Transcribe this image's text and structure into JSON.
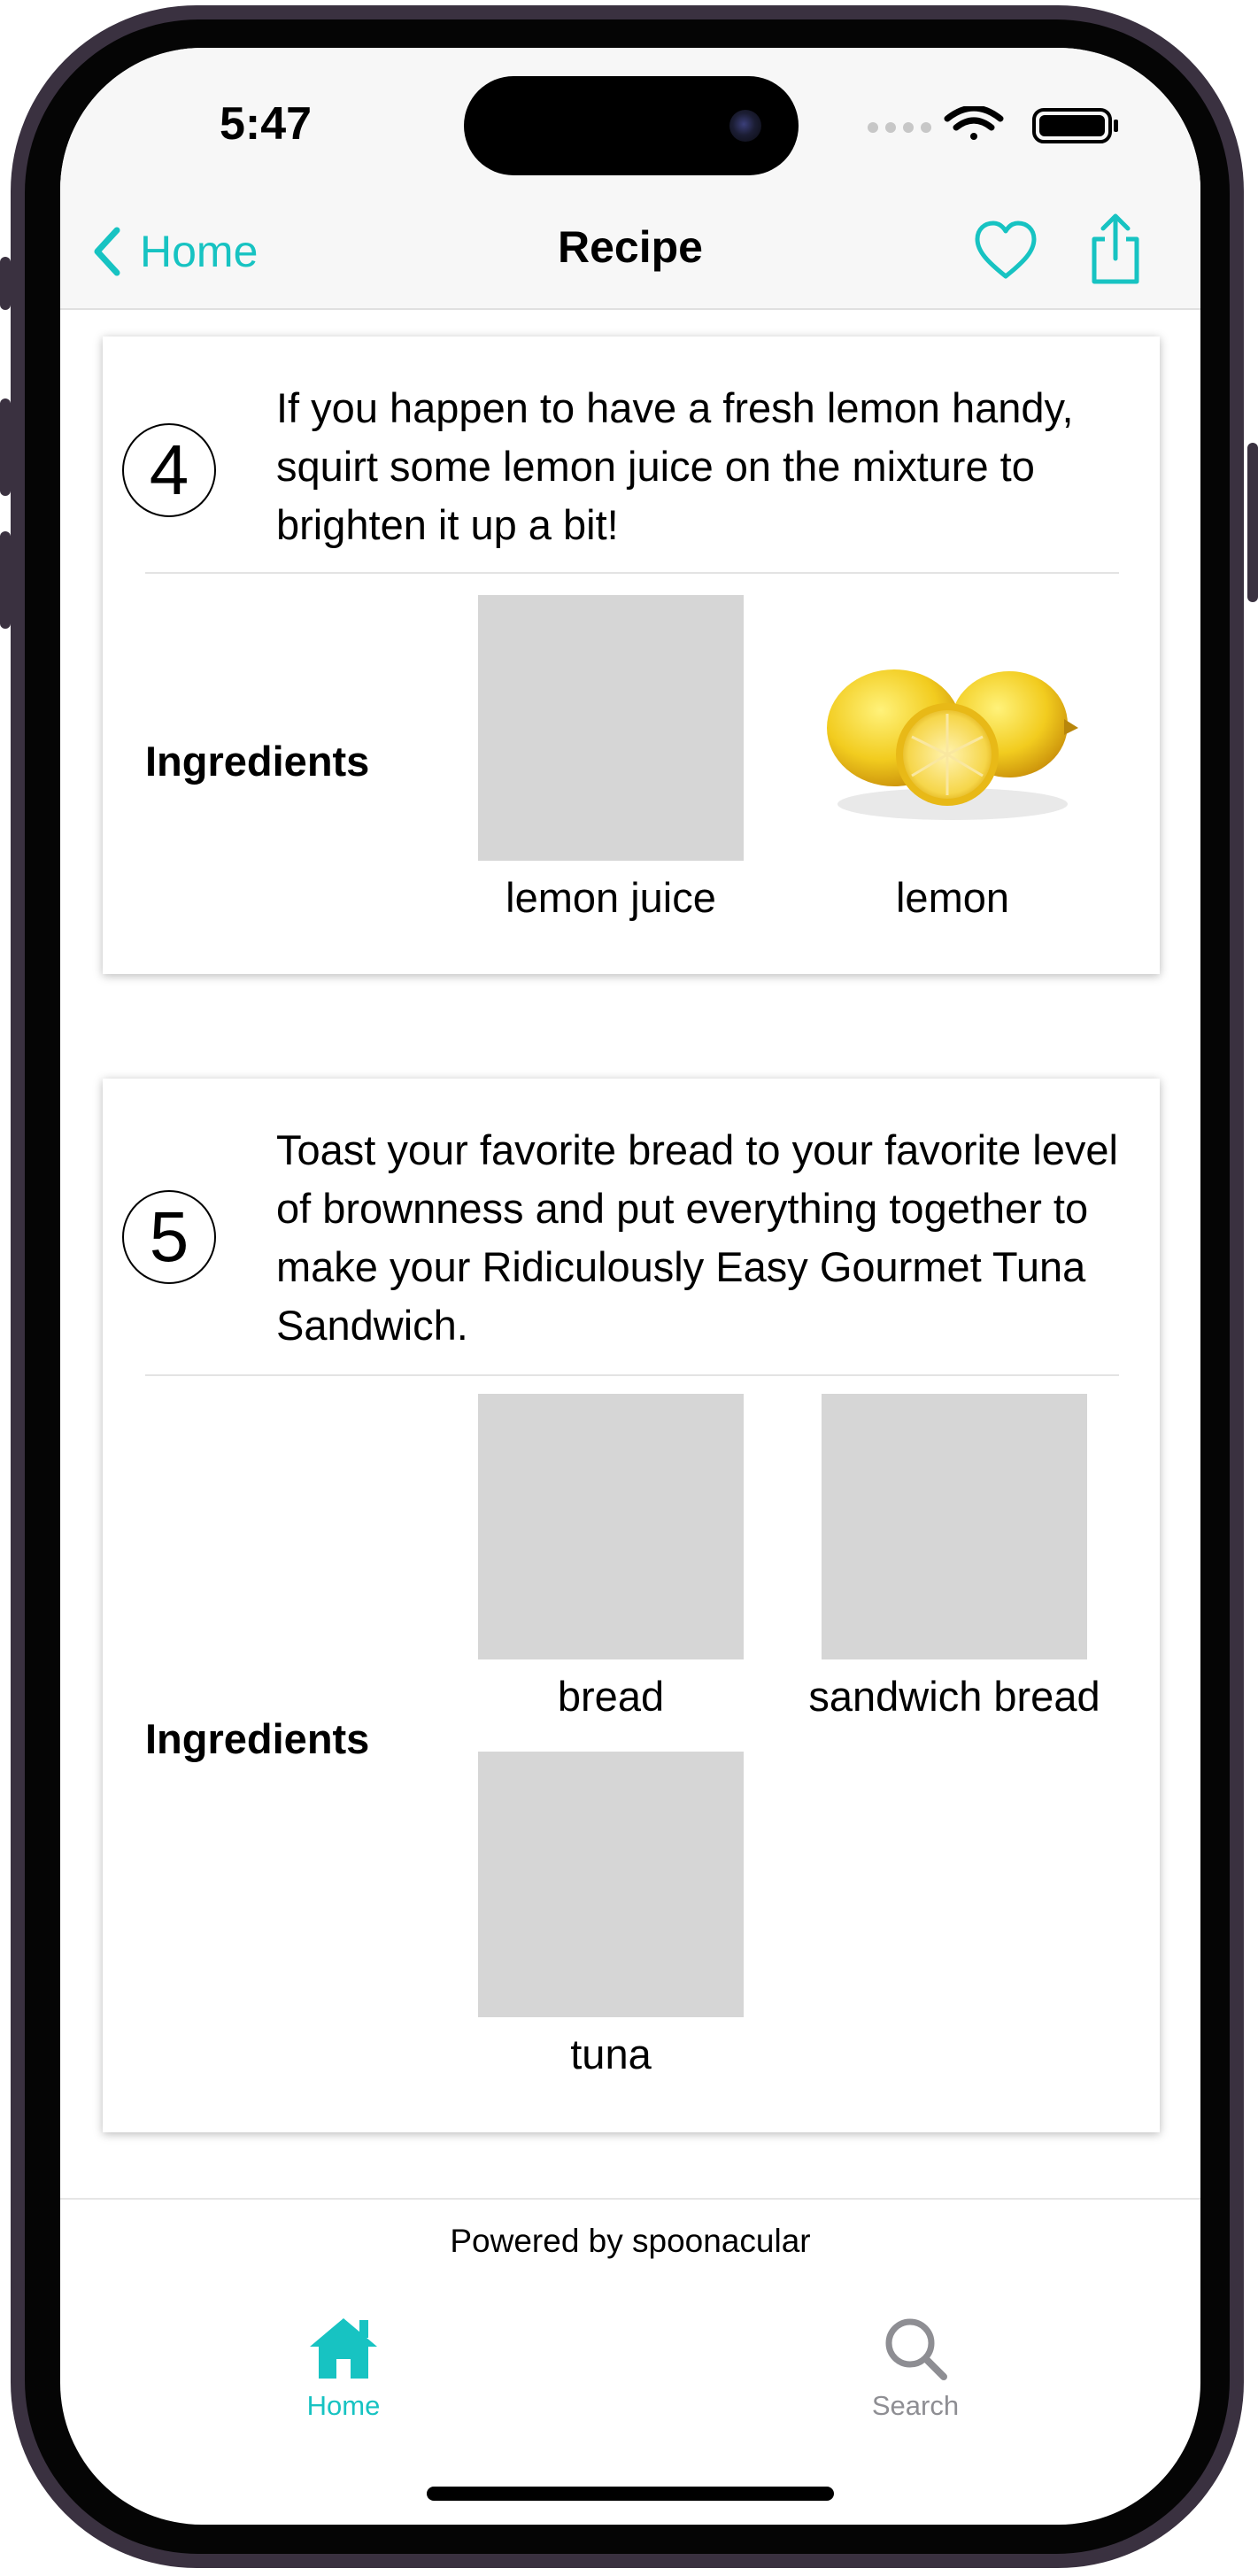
{
  "status_bar": {
    "time": "5:47"
  },
  "nav": {
    "back_label": "Home",
    "title": "Recipe"
  },
  "steps": [
    {
      "number": "4",
      "text": "If you happen to have a fresh lemon handy, squirt some lemon juice on the mixture to brighten it up a bit!",
      "ingredients_label": "Ingredients",
      "ingredients": [
        {
          "name": "lemon juice",
          "image": "placeholder"
        },
        {
          "name": "lemon",
          "image": "lemon-photo"
        }
      ]
    },
    {
      "number": "5",
      "text": "Toast your favorite bread to your favorite level of brownness and put everything together to make your Ridiculously Easy Gourmet Tuna Sandwich.",
      "ingredients_label": "Ingredients",
      "ingredients": [
        {
          "name": "bread",
          "image": "placeholder"
        },
        {
          "name": "sandwich bread",
          "image": "placeholder"
        },
        {
          "name": "tuna",
          "image": "placeholder"
        }
      ]
    }
  ],
  "footer": {
    "powered_by": "Powered by spoonacular"
  },
  "tabbar": {
    "home_label": "Home",
    "search_label": "Search",
    "active": "home"
  },
  "colors": {
    "accent": "#17c3c2",
    "inactive": "#8e8e93",
    "placeholder": "#d6d6d6"
  }
}
